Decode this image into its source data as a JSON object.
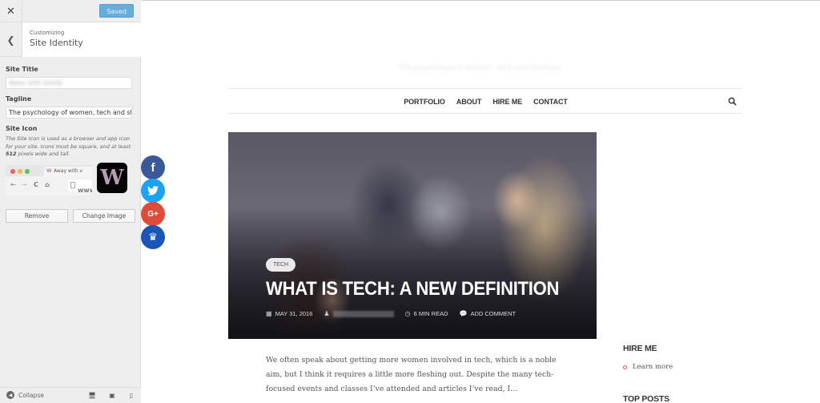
{
  "customizer": {
    "close_icon": "close-icon",
    "saved_label": "Saved",
    "breadcrumb": "Customizing",
    "section_title": "Site Identity",
    "site_title_label": "Site Title",
    "site_title_value": "Away with words",
    "tagline_label": "Tagline",
    "tagline_value": "The psychology of women, tech and sta",
    "site_icon_label": "Site Icon",
    "site_icon_desc_1": "The Site Icon is used as a browser and app icon for your site. Icons must be square, and at least ",
    "site_icon_desc_bold": "512",
    "site_icon_desc_2": " pixels wide and tall.",
    "preview": {
      "tab_title": "Away with v",
      "tab_favicon": "W",
      "url_text": "www.",
      "app_icon_letter": "W",
      "dot_colors": [
        "#ee5f5b",
        "#f5b73b",
        "#5cc15c"
      ],
      "nav_back": "←",
      "nav_forward": "→",
      "nav_reload": "C",
      "nav_home": "⌂"
    },
    "remove_label": "Remove",
    "change_image_label": "Change Image",
    "collapse_label": "Collapse",
    "devices": [
      "desktop",
      "tablet",
      "mobile"
    ]
  },
  "share": [
    {
      "name": "facebook",
      "glyph": "f",
      "color": "#3b5998"
    },
    {
      "name": "twitter",
      "glyph": "🐦",
      "color": "#1da1f2"
    },
    {
      "name": "google-plus",
      "glyph": "G+",
      "color": "#dd4b39"
    },
    {
      "name": "crown",
      "glyph": "♛",
      "color": "#1a56b8"
    }
  ],
  "site": {
    "tagline": "The psychology of women, tech and startups",
    "nav": [
      "PORTFOLIO",
      "ABOUT",
      "HIRE ME",
      "CONTACT"
    ],
    "post": {
      "category": "TECH",
      "title": "WHAT IS TECH: A NEW DEFINITION",
      "date": "MAY 31, 2016",
      "read_time": "6 MIN READ",
      "comment": "ADD COMMENT",
      "excerpt": "We often speak about getting more women involved in tech, which is a noble aim, but I think it requires a little more fleshing out. Despite the many tech-focused events and classes I’ve attended and articles I’ve read, I…"
    },
    "sidebar": {
      "widget1_title": "HIRE ME",
      "widget1_link": "Learn more",
      "widget2_title": "TOP POSTS"
    }
  }
}
